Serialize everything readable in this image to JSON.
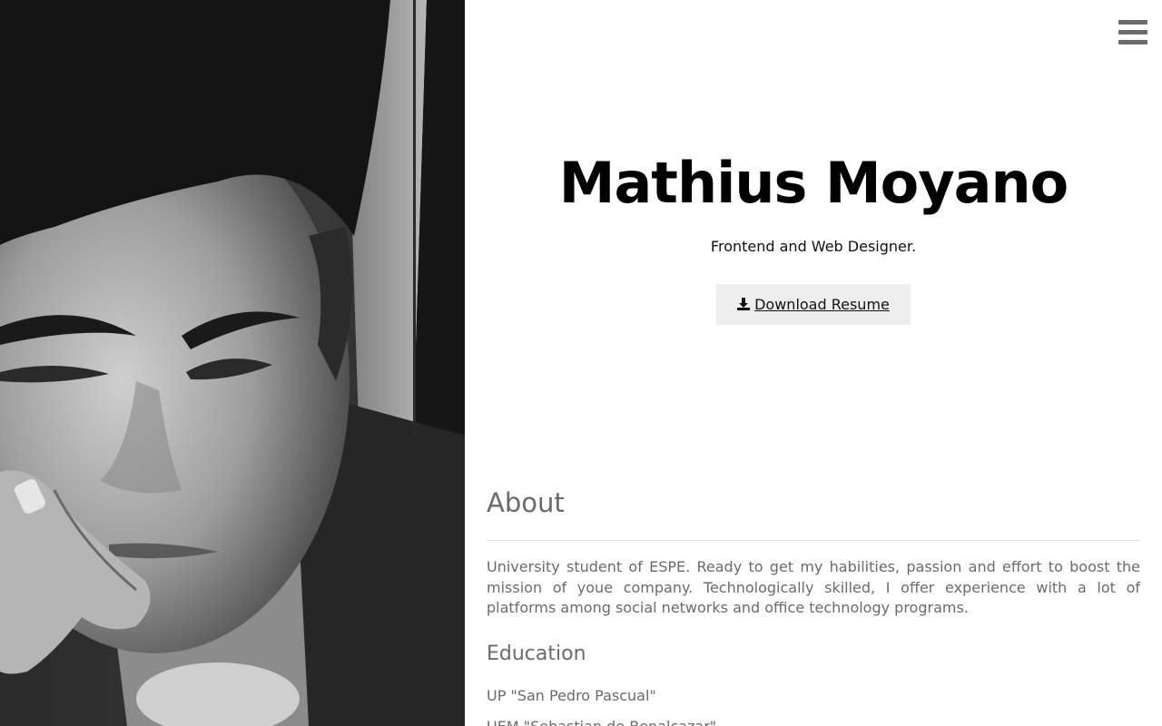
{
  "profile": {
    "name": "Mathius Moyano",
    "tagline": "Frontend and Web Designer.",
    "download_label": "Download Resume"
  },
  "icons": {
    "menu": "hamburger-menu-icon",
    "download": "download-icon"
  },
  "about": {
    "heading": "About",
    "text": "University student of ESPE. Ready to get my habilities, passion and effort to boost the mission of youe company. Technologically skilled, I offer experience with a lot of platforms among social networks and office technology programs."
  },
  "education": {
    "heading": "Education",
    "items": [
      "UP \"San Pedro Pascual\"",
      "UEM \"Sebastian de Benalcazar\""
    ]
  },
  "colors": {
    "heading": "#000000",
    "body_text": "#6b6b6b",
    "button_bg": "#eeeeee",
    "menu_icon": "#6b6b6b"
  }
}
